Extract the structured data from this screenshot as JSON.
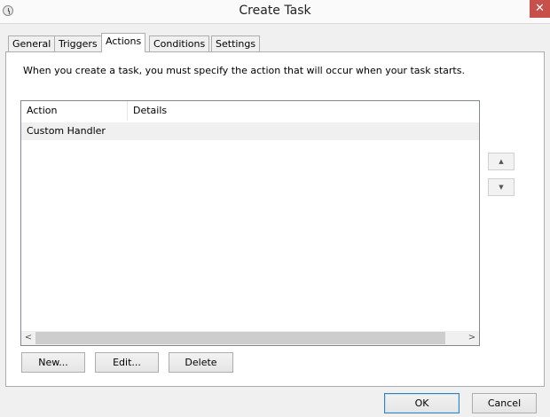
{
  "window": {
    "title": "Create Task",
    "close_label": "✕"
  },
  "tabs": [
    {
      "label": "General"
    },
    {
      "label": "Triggers"
    },
    {
      "label": "Actions"
    },
    {
      "label": "Conditions"
    },
    {
      "label": "Settings"
    }
  ],
  "active_tab": "Actions",
  "description": "When you create a task, you must specify the action that will occur when your task starts.",
  "table": {
    "columns": [
      "Action",
      "Details"
    ],
    "rows": [
      {
        "action": "Custom Handler",
        "details": ""
      }
    ]
  },
  "buttons": {
    "new": "New...",
    "edit": "Edit...",
    "delete": "Delete",
    "ok": "OK",
    "cancel": "Cancel",
    "move_up": "▲",
    "move_down": "▼",
    "scroll_left": "<",
    "scroll_right": ">"
  }
}
